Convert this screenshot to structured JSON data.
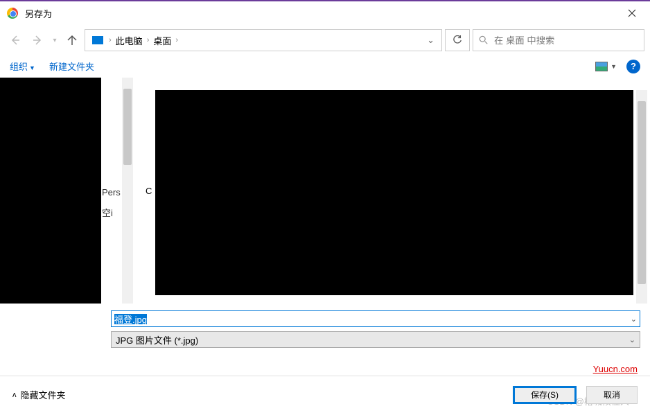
{
  "title": "另存为",
  "breadcrumb": {
    "root": "此电脑",
    "sep": "›",
    "current": "桌面"
  },
  "search": {
    "placeholder": "在 桌面 中搜索"
  },
  "toolbar": {
    "organize": "组织",
    "new_folder": "新建文件夹"
  },
  "sidebar": {
    "partial_labels": [
      "Pers",
      "空i"
    ]
  },
  "main": {
    "col_letter": "C"
  },
  "file": {
    "name_value": "福登.jpg",
    "type_value": "JPG 图片文件 (*.jpg)"
  },
  "bottom": {
    "hide_folders": "隐藏文件夹",
    "save": "保存(S)",
    "cancel": "取消"
  },
  "watermark": {
    "red": "Yuucn.com",
    "gray": "CSDN @榕城候佳人"
  }
}
